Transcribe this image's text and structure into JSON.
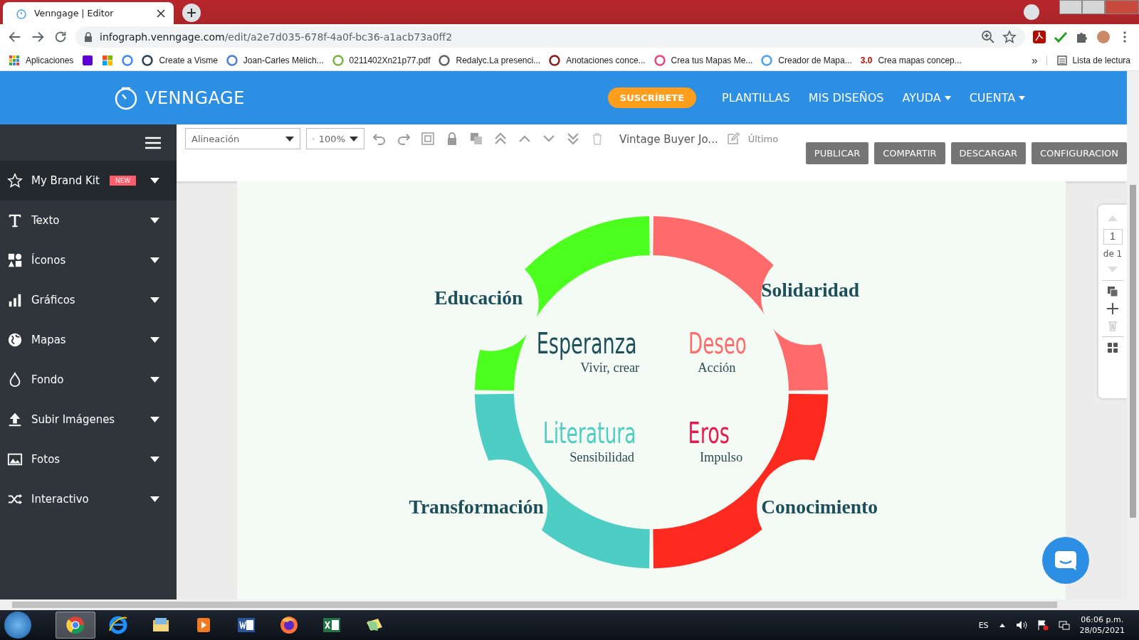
{
  "browser": {
    "tab_title": "Venngage | Editor",
    "url_host": "infograph.venngage.com",
    "url_path": "/edit/a2e7d035-678f-4a0f-bc36-a1acb73a0ff2",
    "bookmarks": [
      {
        "kind": "link",
        "label": "Aplicaciones"
      },
      {
        "kind": "icon"
      },
      {
        "kind": "icon"
      },
      {
        "kind": "icon"
      },
      {
        "kind": "link",
        "label": "Create a Visme"
      },
      {
        "kind": "link",
        "label": "Joan-Carles Mèlich..."
      },
      {
        "kind": "link",
        "label": "0211402Xn21p77.pdf"
      },
      {
        "kind": "link",
        "label": "Redalyc.La presenci..."
      },
      {
        "kind": "link",
        "label": "Anotaciones conce..."
      },
      {
        "kind": "link",
        "label": "Crea tus Mapas Me..."
      },
      {
        "kind": "link",
        "label": "Creador de Mapa..."
      },
      {
        "kind": "prefixed",
        "prefix": "3.0",
        "label": "Crea mapas concep..."
      }
    ],
    "more": "»",
    "reading_list": "Lista de lectura"
  },
  "app": {
    "logo": "VENNGAGE",
    "subscribe": "SUSCRÍBETE",
    "nav": [
      {
        "label": "PLANTILLAS",
        "dropdown": false
      },
      {
        "label": "MIS DISEÑOS",
        "dropdown": false
      },
      {
        "label": "AYUDA",
        "dropdown": true
      },
      {
        "label": "CUENTA",
        "dropdown": true
      }
    ]
  },
  "sidebar": {
    "items": [
      {
        "label": "My Brand Kit",
        "badge": "NEW",
        "selected": true
      },
      {
        "label": "Texto",
        "selected": false
      },
      {
        "label": "Íconos",
        "selected": false
      },
      {
        "label": "Gráficos",
        "selected": false
      },
      {
        "label": "Mapas",
        "selected": false
      },
      {
        "label": "Fondo",
        "selected": false
      },
      {
        "label": "Subir Imágenes",
        "selected": false
      },
      {
        "label": "Fotos",
        "selected": false
      },
      {
        "label": "Interactivo",
        "selected": false
      }
    ]
  },
  "toolbar": {
    "alignment": "Alineación",
    "zoom": "100%",
    "document_title": "Vintage Buyer Jo...",
    "last_saved": "Último",
    "buttons": [
      "PUBLICAR",
      "COMPARTIR",
      "DESCARGAR",
      "CONFIGURACION"
    ]
  },
  "diagram": {
    "segments": [
      {
        "label": "Educación",
        "color": "#4cff1f"
      },
      {
        "label": "Solidaridad",
        "color": "#ff6b6b"
      },
      {
        "label": "Transformación",
        "color": "#4ecdc4"
      },
      {
        "label": "Conocimiento",
        "color": "#ff2a1f"
      }
    ],
    "words": [
      {
        "title": "Esperanza",
        "subtitle": "Vivir, crear",
        "color": "#1d4f5a"
      },
      {
        "title": "Deseo",
        "subtitle": "Acción",
        "color": "#ff6b6b"
      },
      {
        "title": "Literatura",
        "subtitle": "Sensibilidad",
        "color": "#4ecdc4"
      },
      {
        "title": "Eros",
        "subtitle": "Impulso",
        "color": "#e8194a"
      }
    ]
  },
  "page_nav": {
    "page": "1",
    "of": "de 1"
  },
  "taskbar": {
    "apps": [
      {
        "selected": true
      },
      {
        "selected": false
      },
      {
        "selected": false
      },
      {
        "selected": false
      },
      {
        "selected": false
      },
      {
        "selected": false
      },
      {
        "selected": false
      },
      {
        "selected": false
      }
    ],
    "language": "ES",
    "time": "06:06 p.m.",
    "date": "28/05/2021"
  }
}
